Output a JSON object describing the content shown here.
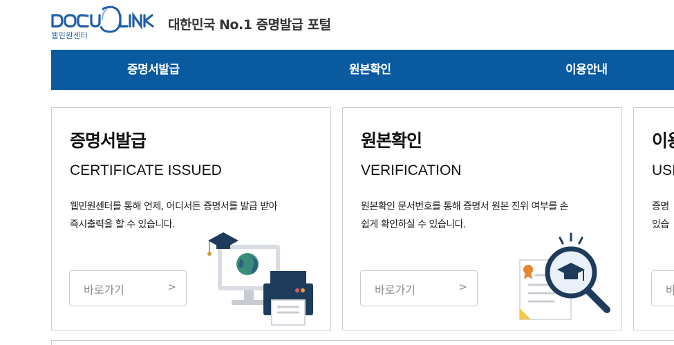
{
  "header": {
    "logo_text": "DOCU LINK",
    "logo_sub": "웹민원센터",
    "tagline": "대한민국 No.1 증명발급 포털",
    "brand_color": "#0a5aa0"
  },
  "nav": {
    "items": [
      {
        "label": "증명서발급"
      },
      {
        "label": "원본확인"
      },
      {
        "label": "이용안내"
      }
    ]
  },
  "cards": [
    {
      "title": "증명서발급",
      "subtitle": "CERTIFICATE ISSUED",
      "desc_line1": "웹민원센터를 통해 언제, 어디서든 증명서를 발급 받아",
      "desc_line2": "즉시출력을 할 수 있습니다.",
      "button_label": "바로가기",
      "button_arrow": ">",
      "illustration": "computer-printer-graduation-icon"
    },
    {
      "title": "원본확인",
      "subtitle": "VERIFICATION",
      "desc_line1": "원본확인 문서번호를 통해 증명서 원본 진위 여부를 손",
      "desc_line2": "쉽게 확인하실 수 있습니다.",
      "button_label": "바로가기",
      "button_arrow": ">",
      "illustration": "certificate-magnifier-icon"
    },
    {
      "title": "이용",
      "subtitle": "USI",
      "desc_line1": "증명",
      "desc_line2": "있습",
      "button_label": "바",
      "button_arrow": ""
    }
  ]
}
